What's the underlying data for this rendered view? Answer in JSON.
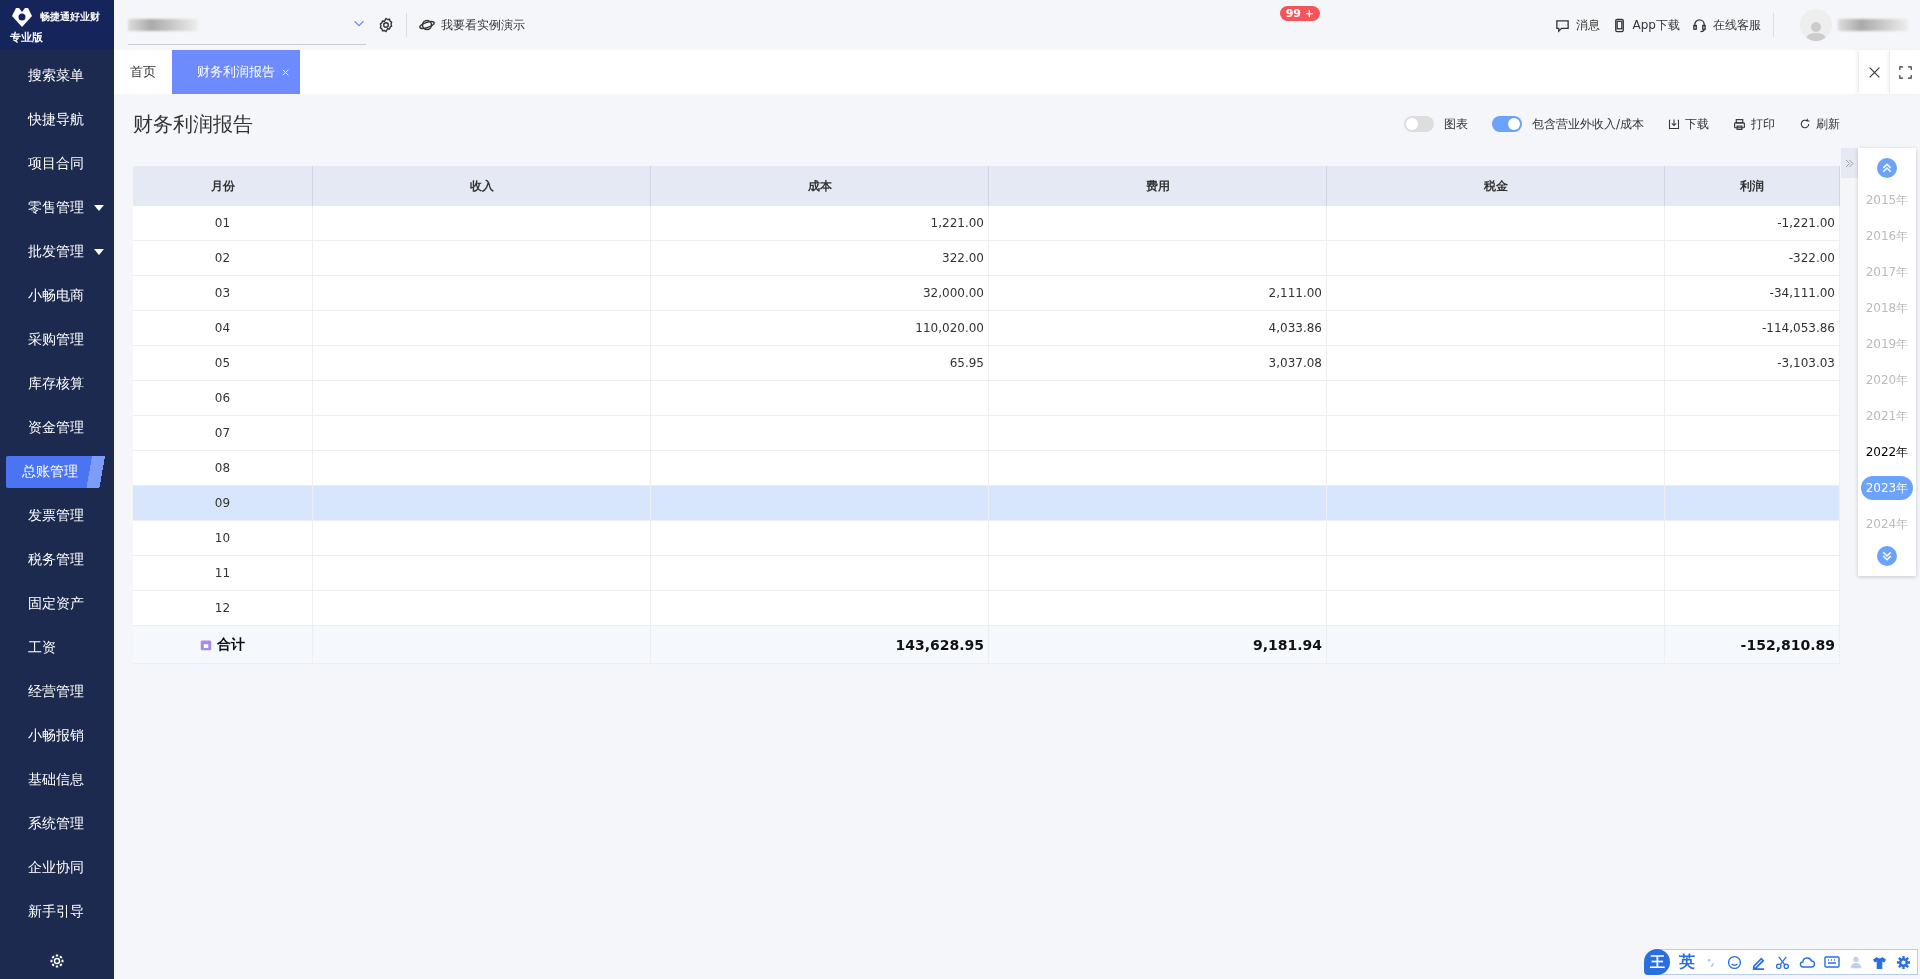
{
  "app": {
    "logo_text": "畅捷通好业财",
    "edition": "专业版"
  },
  "sidebar": {
    "items": [
      {
        "label": "搜索菜单",
        "expandable": false,
        "selected": false
      },
      {
        "label": "快捷导航",
        "expandable": false,
        "selected": false
      },
      {
        "label": "项目合同",
        "expandable": false,
        "selected": false
      },
      {
        "label": "零售管理",
        "expandable": true,
        "selected": false
      },
      {
        "label": "批发管理",
        "expandable": true,
        "selected": false
      },
      {
        "label": "小畅电商",
        "expandable": false,
        "selected": false
      },
      {
        "label": "采购管理",
        "expandable": false,
        "selected": false
      },
      {
        "label": "库存核算",
        "expandable": false,
        "selected": false
      },
      {
        "label": "资金管理",
        "expandable": false,
        "selected": false
      },
      {
        "label": "总账管理",
        "expandable": false,
        "selected": true
      },
      {
        "label": "发票管理",
        "expandable": false,
        "selected": false
      },
      {
        "label": "税务管理",
        "expandable": false,
        "selected": false
      },
      {
        "label": "固定资产",
        "expandable": false,
        "selected": false
      },
      {
        "label": "工资",
        "expandable": false,
        "selected": false
      },
      {
        "label": "经营管理",
        "expandable": false,
        "selected": false
      },
      {
        "label": "小畅报销",
        "expandable": false,
        "selected": false
      },
      {
        "label": "基础信息",
        "expandable": false,
        "selected": false
      },
      {
        "label": "系统管理",
        "expandable": false,
        "selected": false
      },
      {
        "label": "企业协同",
        "expandable": false,
        "selected": false
      },
      {
        "label": "新手引导",
        "expandable": false,
        "selected": false
      }
    ]
  },
  "topbar": {
    "demo_link": "我要看实例演示",
    "messages": {
      "label": "消息",
      "badge": "99 +"
    },
    "app_download": "App下载",
    "support": "在线客服"
  },
  "tabs": [
    {
      "label": "首页",
      "selected": false,
      "closable": false
    },
    {
      "label": "财务利润报告",
      "selected": true,
      "closable": true
    }
  ],
  "report": {
    "title": "财务利润报告",
    "toggles": [
      {
        "label": "图表",
        "on": false
      },
      {
        "label": "包含营业外收入/成本",
        "on": true
      }
    ],
    "actions": [
      {
        "kind": "download",
        "label": "下载"
      },
      {
        "kind": "print",
        "label": "打印"
      },
      {
        "kind": "refresh",
        "label": "刷新"
      }
    ]
  },
  "table": {
    "columns": [
      "月份",
      "收入",
      "成本",
      "费用",
      "税金",
      "利润"
    ],
    "rows": [
      {
        "cells": [
          "01",
          "",
          "1,221.00",
          "",
          "",
          "-1,221.00"
        ],
        "selected": false
      },
      {
        "cells": [
          "02",
          "",
          "322.00",
          "",
          "",
          "-322.00"
        ],
        "selected": false
      },
      {
        "cells": [
          "03",
          "",
          "32,000.00",
          "2,111.00",
          "",
          "-34,111.00"
        ],
        "selected": false
      },
      {
        "cells": [
          "04",
          "",
          "110,020.00",
          "4,033.86",
          "",
          "-114,053.86"
        ],
        "selected": false
      },
      {
        "cells": [
          "05",
          "",
          "65.95",
          "3,037.08",
          "",
          "-3,103.03"
        ],
        "selected": false
      },
      {
        "cells": [
          "06",
          "",
          "",
          "",
          "",
          ""
        ],
        "selected": false
      },
      {
        "cells": [
          "07",
          "",
          "",
          "",
          "",
          ""
        ],
        "selected": false
      },
      {
        "cells": [
          "08",
          "",
          "",
          "",
          "",
          ""
        ],
        "selected": false
      },
      {
        "cells": [
          "09",
          "",
          "",
          "",
          "",
          ""
        ],
        "selected": true
      },
      {
        "cells": [
          "10",
          "",
          "",
          "",
          "",
          ""
        ],
        "selected": false
      },
      {
        "cells": [
          "11",
          "",
          "",
          "",
          "",
          ""
        ],
        "selected": false
      },
      {
        "cells": [
          "12",
          "",
          "",
          "",
          "",
          ""
        ],
        "selected": false
      }
    ],
    "total": {
      "label": "合计",
      "cells": [
        "",
        "143,628.95",
        "9,181.94",
        "",
        "-152,810.89"
      ]
    }
  },
  "years": [
    {
      "label": "2015年",
      "disabled": true,
      "selected": false
    },
    {
      "label": "2016年",
      "disabled": true,
      "selected": false
    },
    {
      "label": "2017年",
      "disabled": true,
      "selected": false
    },
    {
      "label": "2018年",
      "disabled": true,
      "selected": false
    },
    {
      "label": "2019年",
      "disabled": true,
      "selected": false
    },
    {
      "label": "2020年",
      "disabled": true,
      "selected": false
    },
    {
      "label": "2021年",
      "disabled": true,
      "selected": false
    },
    {
      "label": "2022年",
      "disabled": false,
      "selected": false
    },
    {
      "label": "2023年",
      "disabled": false,
      "selected": true
    },
    {
      "label": "2024年",
      "disabled": true,
      "selected": false
    }
  ],
  "ime": {
    "logo": "王",
    "mode": "英"
  }
}
